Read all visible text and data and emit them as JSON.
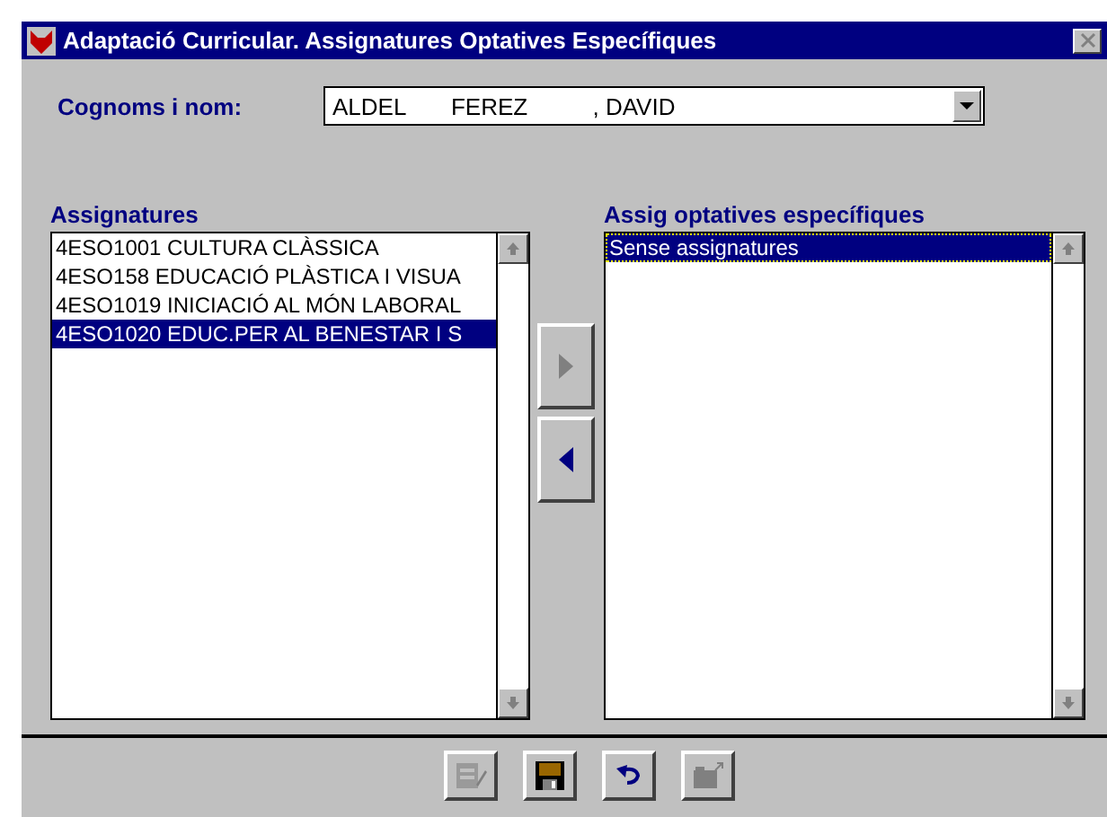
{
  "window": {
    "title": "Adaptació Curricular. Assignatures Optatives Específiques"
  },
  "student": {
    "label": "Cognoms i nom:",
    "value": "ALDEL       FEREZ          , DAVID"
  },
  "available": {
    "title": "Assignatures",
    "items": [
      {
        "text": "4ESO1001 CULTURA CLÀSSICA",
        "selected": false
      },
      {
        "text": "4ESO158  EDUCACIÓ PLÀSTICA I VISUA",
        "selected": false
      },
      {
        "text": "4ESO1019 INICIACIÓ AL MÓN LABORAL",
        "selected": false
      },
      {
        "text": "4ESO1020 EDUC.PER AL BENESTAR I S",
        "selected": true
      }
    ]
  },
  "move_buttons": [
    {
      "kind": "right",
      "disabled": true
    },
    {
      "kind": "left",
      "disabled": false
    }
  ],
  "chosen": {
    "title": "Assig optatives específiques",
    "items": [
      {
        "text": "Sense assignatures",
        "selected": true
      }
    ]
  },
  "toolbar": [
    {
      "kind": "edit",
      "disabled": true
    },
    {
      "kind": "save",
      "disabled": false
    },
    {
      "kind": "undo",
      "disabled": false
    },
    {
      "kind": "export",
      "disabled": true
    }
  ]
}
